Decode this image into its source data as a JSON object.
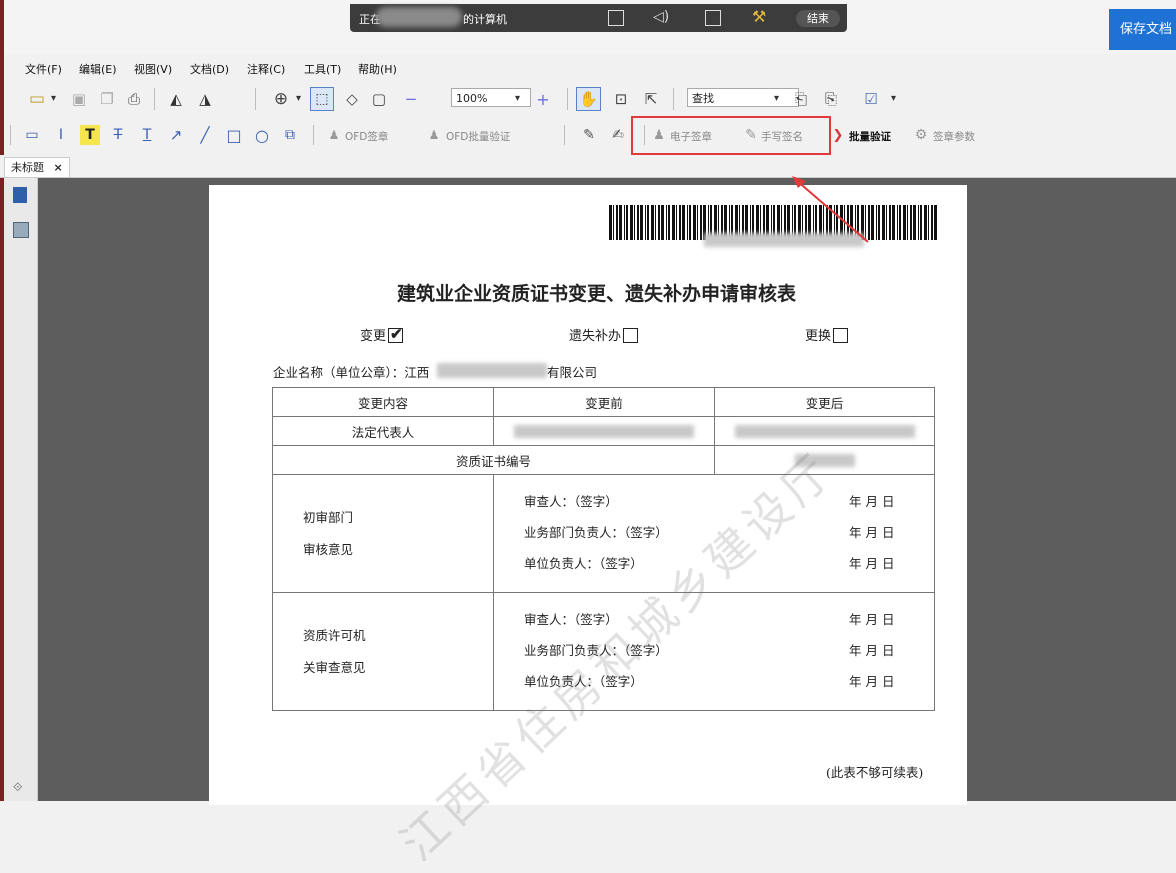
{
  "remote_bar": {
    "status_prefix": "正在",
    "status_suffix": "的计算机",
    "end_label": "结束"
  },
  "save_button_label": "保存文档",
  "menu": [
    "文件(F)",
    "编辑(E)",
    "视图(V)",
    "文档(D)",
    "注释(C)",
    "工具(T)",
    "帮助(H)"
  ],
  "toolbar1": {
    "zoom_value": "100%",
    "search_placeholder": "查找"
  },
  "toolbar2": {
    "ofd_sign": "OFD签章",
    "ofd_batch_verify": "OFD批量验证",
    "e_seal": "电子签章",
    "handwrite_sign": "手写签名",
    "batch_verify": "批量验证",
    "seal_params": "签章参数"
  },
  "doc_tab": {
    "title": "未标题",
    "close": "×"
  },
  "document": {
    "title": "建筑业企业资质证书变更、遗失补办申请审核表",
    "checks": [
      {
        "label": "变更",
        "checked": true
      },
      {
        "label": "遗失补办",
        "checked": false
      },
      {
        "label": "更换",
        "checked": false
      }
    ],
    "company_label": "企业名称（单位公章）：江西",
    "company_suffix": "有限公司",
    "table": {
      "headers": [
        "变更内容",
        "变更前",
        "变更后"
      ],
      "row_legal": "法定代表人",
      "row_cert": "资质证书编号",
      "section1_title": [
        "初审部门",
        "审核意见"
      ],
      "section2_title": [
        "资质许可机",
        "关审查意见"
      ],
      "sign_lines": [
        "审查人：（签字）",
        "业务部门负责人：（签字）",
        "单位负责人：（签字）"
      ],
      "date_text": "年 月 日"
    },
    "footer_note": "(此表不够可续表)",
    "watermark": "江西省住房和城乡建设厅"
  }
}
